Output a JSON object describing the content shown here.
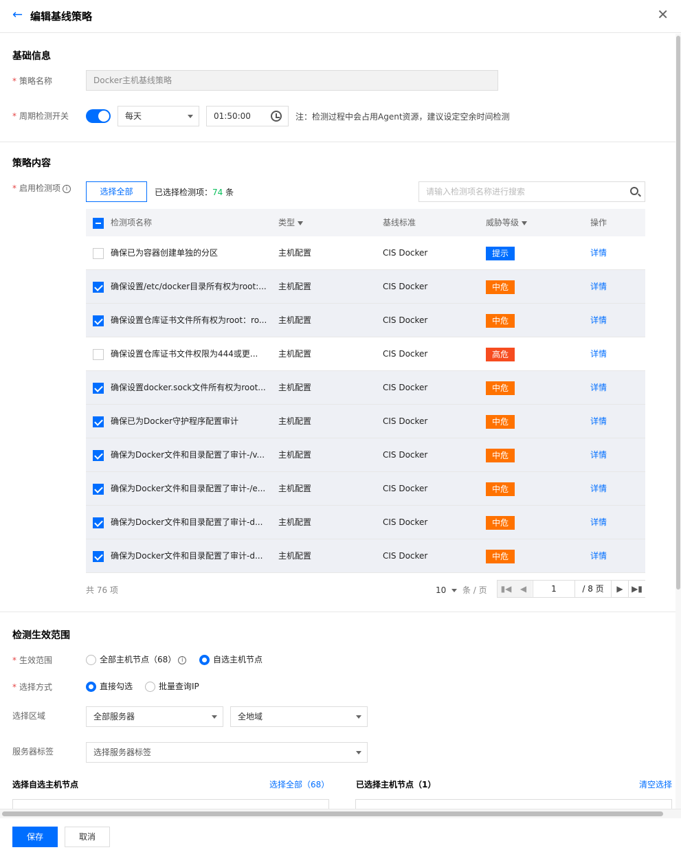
{
  "header": {
    "title": "编辑基线策略",
    "back_icon": "arrow-left-icon",
    "close_icon": "close-icon"
  },
  "basic": {
    "section_title": "基础信息",
    "name_label": "策略名称",
    "name_value": "Docker主机基线策略",
    "cycle_label": "周期检测开关",
    "cycle_toggle_on": true,
    "frequency": "每天",
    "time": "01:50:00",
    "note": "注：检测过程中会占用Agent资源，建议设定空余时间检测"
  },
  "content": {
    "section_title": "策略内容",
    "enable_label": "启用检测项",
    "select_all": "选择全部",
    "selected_prefix": "已选择检测项：",
    "selected_count": "74",
    "selected_suffix": "条",
    "search_placeholder": "请输入检测项名称进行搜索",
    "columns": {
      "name": "检测项名称",
      "type": "类型",
      "standard": "基线标准",
      "level": "威胁等级",
      "action": "操作"
    },
    "rows": [
      {
        "checked": false,
        "name": "确保已为容器创建单独的分区",
        "type": "主机配置",
        "standard": "CIS Docker",
        "level": "提示",
        "level_color": "#006eff",
        "action": "详情"
      },
      {
        "checked": true,
        "name": "确保设置/etc/docker目录所有权为root:...",
        "type": "主机配置",
        "standard": "CIS Docker",
        "level": "中危",
        "level_color": "#ff7200",
        "action": "详情"
      },
      {
        "checked": true,
        "name": "确保设置仓库证书文件所有权为root：ro...",
        "type": "主机配置",
        "standard": "CIS Docker",
        "level": "中危",
        "level_color": "#ff7200",
        "action": "详情"
      },
      {
        "checked": false,
        "name": "确保设置仓库证书文件权限为444或更...",
        "type": "主机配置",
        "standard": "CIS Docker",
        "level": "高危",
        "level_color": "#f64c1f",
        "action": "详情"
      },
      {
        "checked": true,
        "name": "确保设置docker.sock文件所有权为root...",
        "type": "主机配置",
        "standard": "CIS Docker",
        "level": "中危",
        "level_color": "#ff7200",
        "action": "详情"
      },
      {
        "checked": true,
        "name": "确保已为Docker守护程序配置审计",
        "type": "主机配置",
        "standard": "CIS Docker",
        "level": "中危",
        "level_color": "#ff7200",
        "action": "详情"
      },
      {
        "checked": true,
        "name": "确保为Docker文件和目录配置了审计-/v...",
        "type": "主机配置",
        "standard": "CIS Docker",
        "level": "中危",
        "level_color": "#ff7200",
        "action": "详情"
      },
      {
        "checked": true,
        "name": "确保为Docker文件和目录配置了审计-/e...",
        "type": "主机配置",
        "standard": "CIS Docker",
        "level": "中危",
        "level_color": "#ff7200",
        "action": "详情"
      },
      {
        "checked": true,
        "name": "确保为Docker文件和目录配置了审计-d...",
        "type": "主机配置",
        "standard": "CIS Docker",
        "level": "中危",
        "level_color": "#ff7200",
        "action": "详情"
      },
      {
        "checked": true,
        "name": "确保为Docker文件和目录配置了审计-d...",
        "type": "主机配置",
        "standard": "CIS Docker",
        "level": "中危",
        "level_color": "#ff7200",
        "action": "详情"
      }
    ],
    "pager": {
      "total": "共 76 项",
      "page_size": "10",
      "per_page_unit": "条 / 页",
      "current_page": "1",
      "total_pages": "/ 8 页"
    }
  },
  "scope": {
    "section_title": "检测生效范围",
    "range_label": "生效范围",
    "range_all": "全部主机节点（68）",
    "range_custom": "自选主机节点",
    "range_selected": "custom",
    "mode_label": "选择方式",
    "mode_direct": "直接勾选",
    "mode_batch": "批量查询IP",
    "mode_selected": "direct",
    "region_label": "选择区域",
    "region_server": "全部服务器",
    "region_area": "全地域",
    "tag_label": "服务器标签",
    "tag_placeholder": "选择服务器标签",
    "left_title": "选择自选主机节点",
    "left_select_all": "选择全部（68）",
    "right_title": "已选择主机节点（1）",
    "right_clear": "清空选择"
  },
  "footer": {
    "save": "保存",
    "cancel": "取消"
  },
  "colors": {
    "accent": "#006eff",
    "success": "#0abf5b",
    "warning": "#ff7200",
    "danger": "#f64c1f"
  }
}
